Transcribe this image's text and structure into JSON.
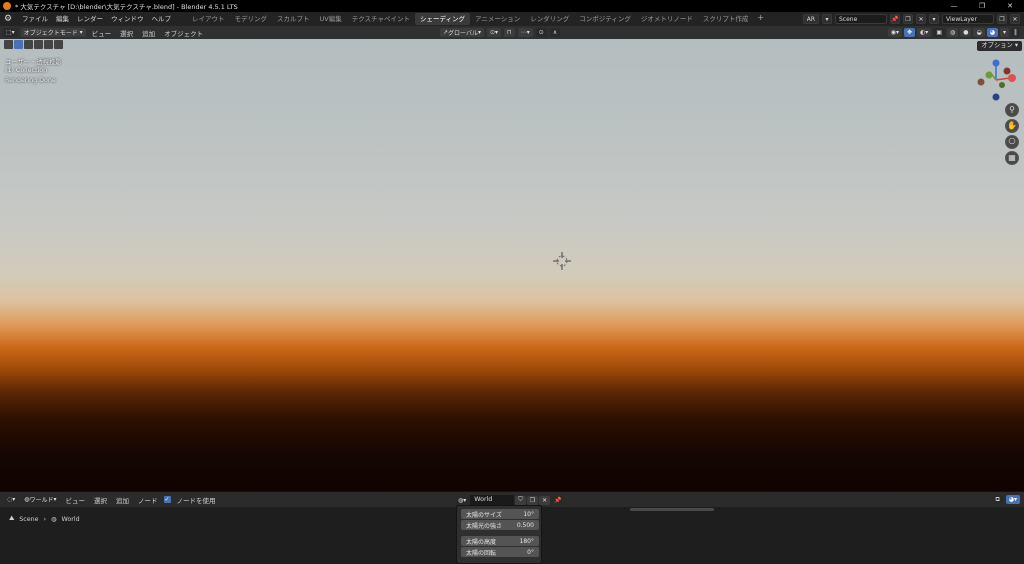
{
  "titlebar": {
    "title": "* 大気テクスチャ [D:\\blender\\大気テクスチャ.blend] - Blender 4.5.1 LTS",
    "minimize": "—",
    "maximize": "❐",
    "close": "✕"
  },
  "menu": {
    "items": [
      "ファイル",
      "編集",
      "レンダー",
      "ウィンドウ",
      "ヘルプ"
    ],
    "workspaces": [
      "レイアウト",
      "モデリング",
      "スカルプト",
      "UV編集",
      "テクスチャペイント",
      "シェーディング",
      "アニメーション",
      "レンダリング",
      "コンポジティング",
      "ジオメトリノード",
      "スクリプト作成"
    ],
    "active_workspace_index": 5,
    "add_tab": "+",
    "ar": "AR",
    "scene": "Scene",
    "view_layer": "ViewLayer"
  },
  "viewport_header": {
    "mode": "オブジェクトモード",
    "menus": [
      "ビュー",
      "選択",
      "追加",
      "オブジェクト"
    ],
    "transform_orientation": "グローバル"
  },
  "viewport": {
    "overlay_lines": [
      "ユーザー・透視投影",
      "(1) Collection",
      "Rendering Done"
    ],
    "options": "オプション"
  },
  "node_editor": {
    "editor_type": "ワールド",
    "menus": [
      "ビュー",
      "選択",
      "追加",
      "ノード"
    ],
    "use_nodes": "ノードを使用",
    "world_name": "World",
    "breadcrumb": [
      "Scene",
      "World"
    ],
    "node_rows": [
      {
        "label": "太陽のサイズ",
        "value": "10°"
      },
      {
        "label": "太陽光の強さ",
        "value": "0.500"
      },
      {
        "label": "太陽の高度",
        "value": "180°"
      },
      {
        "label": "太陽の回転",
        "value": "0°"
      }
    ]
  }
}
